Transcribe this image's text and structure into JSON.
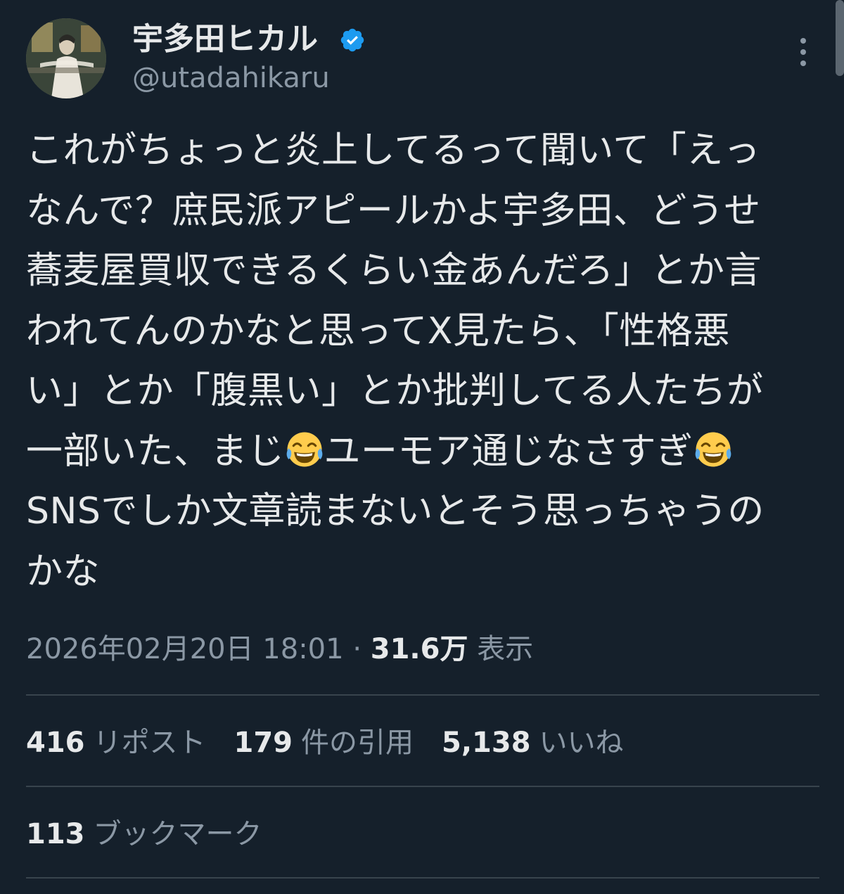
{
  "author": {
    "display_name": "宇多田ヒカル",
    "handle": "@utadahikaru",
    "verified": true,
    "verified_color": "#1d9bf0"
  },
  "tweet": {
    "lines": [
      "これがちょっと炎上してるって聞いて「えっ",
      "なんで？庶民派アピールかよ宇多田、どうせ",
      "蕎麦屋買収できるくらい金あんだろ」とか言",
      "われてんのかなと思ってX見たら、「性格悪",
      "い」とか「腹黒い」とか批判してる人たちが"
    ],
    "line6_part1": "一部いた、まじ",
    "line6_part2": "ユーモア通じなさすぎ",
    "line7": "SNSでしか文章読まないとそう思っちゃうの",
    "line8": "かな",
    "emoji_name": "face-with-tears-of-joy"
  },
  "meta": {
    "timestamp": "2026年02月20日 18:01",
    "separator": "·",
    "views_count": "31.6万",
    "views_label": "表示"
  },
  "stats": {
    "reposts_count": "416",
    "reposts_label": "リポスト",
    "quotes_count": "179",
    "quotes_label": "件の引用",
    "likes_count": "5,138",
    "likes_label": "いいね",
    "bookmarks_count": "113",
    "bookmarks_label": "ブックマーク"
  },
  "colors": {
    "background": "#15202b",
    "text_primary": "#e7e9ea",
    "text_secondary": "#8b98a5",
    "divider": "#38444d"
  },
  "icons": {
    "more": "more-vertical-icon",
    "verified": "verified-badge-icon"
  }
}
